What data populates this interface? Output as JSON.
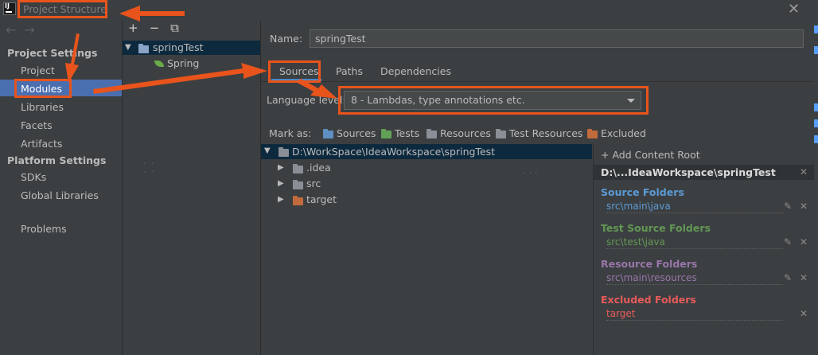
{
  "window": {
    "title": "Project Structure",
    "close_icon": "close-icon"
  },
  "nav": {
    "back_icon": "arrow-left-icon",
    "forward_icon": "arrow-right-icon",
    "project_settings_heading": "Project Settings",
    "project_settings_items": [
      "Project",
      "Modules",
      "Libraries",
      "Facets",
      "Artifacts"
    ],
    "selected_item": "Modules",
    "platform_settings_heading": "Platform Settings",
    "platform_settings_items": [
      "SDKs",
      "Global Libraries"
    ],
    "problems": "Problems"
  },
  "modules": {
    "toolbar": [
      "add-icon",
      "remove-icon",
      "copy-icon"
    ],
    "root": {
      "name": "springTest",
      "expanded": true
    },
    "children": [
      {
        "name": "Spring",
        "icon": "spring-leaf-icon"
      }
    ]
  },
  "editor": {
    "name_label": "Name:",
    "name_value": "springTest",
    "tabs": [
      "Sources",
      "Paths",
      "Dependencies"
    ],
    "active_tab": "Sources",
    "language_level_label": "Language level:",
    "language_level_value": "8 - Lambdas, type annotations etc.",
    "mark_as_label": "Mark as:",
    "mark_as_buttons": [
      {
        "label": "Sources",
        "color": "#5f8fc3"
      },
      {
        "label": "Tests",
        "color": "#62a155"
      },
      {
        "label": "Resources",
        "color": "#8a8e96"
      },
      {
        "label": "Test Resources",
        "color": "#8a8e96"
      },
      {
        "label": "Excluded",
        "color": "#c16a3c"
      }
    ]
  },
  "tree": {
    "root": "D:\\WorkSpace\\IdeaWorkspace\\springTest",
    "children": [
      {
        "name": ".idea",
        "color": "#8a8e96"
      },
      {
        "name": "src",
        "color": "#8a8e96"
      },
      {
        "name": "target",
        "color": "#c16a3c"
      }
    ]
  },
  "roots_panel": {
    "add_content_root": "+ Add Content Root",
    "content_root": "D:\\...IdeaWorkspace\\springTest",
    "sections": [
      {
        "title": "Source Folders",
        "path": "src\\main\\java",
        "color": "#5b9bd5"
      },
      {
        "title": "Test Source Folders",
        "path": "src\\test\\java",
        "color": "#629755"
      },
      {
        "title": "Resource Folders",
        "path": "src\\main\\resources",
        "color": "#9876aa"
      },
      {
        "title": "Excluded Folders",
        "path": "target",
        "color": "#e85a5a"
      }
    ]
  },
  "annotation_color": "#e8541c"
}
